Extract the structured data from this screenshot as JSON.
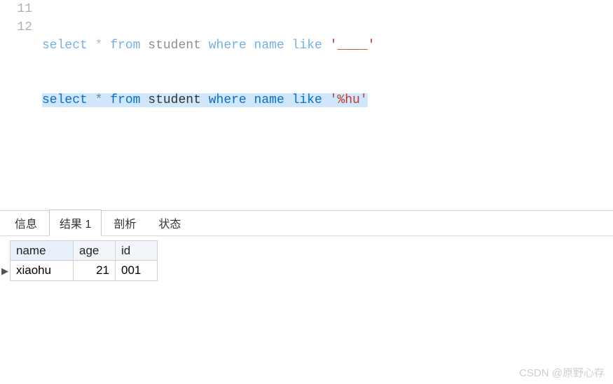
{
  "editor": {
    "lines": [
      {
        "num": "11",
        "kw1": "select",
        "op": "*",
        "kw2": "from",
        "tbl": "student",
        "kw3": "where",
        "col": "name",
        "kw4": "like",
        "str_err": "'____'"
      },
      {
        "num": "12",
        "kw1": "select",
        "op": "*",
        "kw2": "from",
        "tbl": "student",
        "kw3": "where",
        "col": "name",
        "kw4": "like",
        "str": "'%hu'"
      }
    ]
  },
  "tabs": {
    "info": "信息",
    "result": "结果 1",
    "profile": "剖析",
    "status": "状态"
  },
  "result": {
    "columns": {
      "name": "name",
      "age": "age",
      "id": "id"
    },
    "rows": [
      {
        "name": "xiaohu",
        "age": "21",
        "id": "001"
      }
    ],
    "indicator": "▶"
  },
  "watermark": "CSDN @原野心存"
}
